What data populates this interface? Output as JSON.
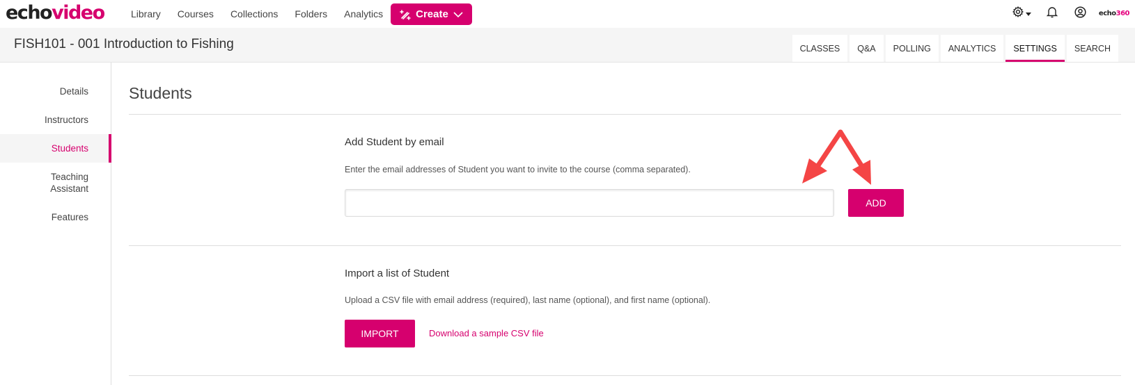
{
  "brand": {
    "logo_echo": "echo",
    "logo_video": "video",
    "accent": "#d6006e"
  },
  "topnav": {
    "links": [
      "Library",
      "Courses",
      "Collections",
      "Folders",
      "Analytics"
    ],
    "create_label": "Create",
    "icons": [
      "settings-icon",
      "caret-down-icon",
      "bell-icon",
      "user-icon"
    ],
    "echo360_echo": "echo",
    "echo360_num": "360"
  },
  "course": {
    "title": "FISH101 - 001 Introduction to Fishing",
    "tabs": [
      "CLASSES",
      "Q&A",
      "POLLING",
      "ANALYTICS",
      "SETTINGS",
      "SEARCH"
    ],
    "active_tab": "SETTINGS"
  },
  "sidebar": {
    "items": [
      {
        "label": "Details"
      },
      {
        "label": "Instructors"
      },
      {
        "label": "Students"
      },
      {
        "label": "Teaching Assistant"
      },
      {
        "label": "Features"
      }
    ],
    "active": "Students"
  },
  "main": {
    "title": "Students",
    "add_section": {
      "title": "Add Student by email",
      "description": "Enter the email addresses of Student you want to invite to the course (comma separated).",
      "input_value": "",
      "add_label": "ADD"
    },
    "import_section": {
      "title": "Import a list of Student",
      "description": "Upload a CSV file with email address (required), last name (optional), and first name (optional).",
      "import_label": "IMPORT",
      "sample_link": "Download a sample CSV file"
    }
  },
  "annotation": {
    "arrow_color": "#f44545"
  }
}
